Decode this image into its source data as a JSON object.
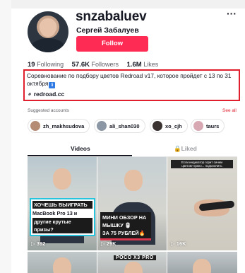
{
  "profile": {
    "username": "snzabaluev",
    "display_name": "Сергей Забалуев",
    "follow_label": "Follow",
    "more_icon": "ellipsis-icon",
    "stats": {
      "following_count": "19",
      "following_label": "Following",
      "followers_count": "57.6K",
      "followers_label": "Followers",
      "likes_count": "1.6M",
      "likes_label": "Likes"
    },
    "bio": "Соревнование по подбору цветов Redroad v17, которое пройдет с 13 по 31 октября",
    "bio_link": "redroad.cc",
    "bio_box_color": "#e0202d"
  },
  "suggested": {
    "title": "Suggested accounts",
    "see_all": "See all",
    "accounts": [
      {
        "name": "zh_makhsudova"
      },
      {
        "name": "ali_shan030"
      },
      {
        "name": "xo_cjh"
      },
      {
        "name": "taurs"
      }
    ]
  },
  "tabs": {
    "videos": "Videos",
    "liked": "Liked"
  },
  "videos": [
    {
      "views": "392",
      "caption_lines": [
        "ХОЧЕШЬ ВЫИГРАТЬ",
        "MacBook Pro 13 и",
        "другие крутые призы?"
      ]
    },
    {
      "views": "29K",
      "caption_lines": [
        "МИНИ ОБЗОР НА",
        "МЫШКУ 🖱️",
        "ЗА 75 РУБЛЕЙ🔥"
      ]
    },
    {
      "views": "16K",
      "caption_lines": [
        "Если индикатор горит синим",
        "цветом-нужно... подключить"
      ]
    }
  ],
  "row2": {
    "poco_label": "POCO X3 PRO"
  },
  "colors": {
    "accent": "#fe2c55",
    "link_red": "#e0202d",
    "caption_cyan": "#27c4dd"
  }
}
